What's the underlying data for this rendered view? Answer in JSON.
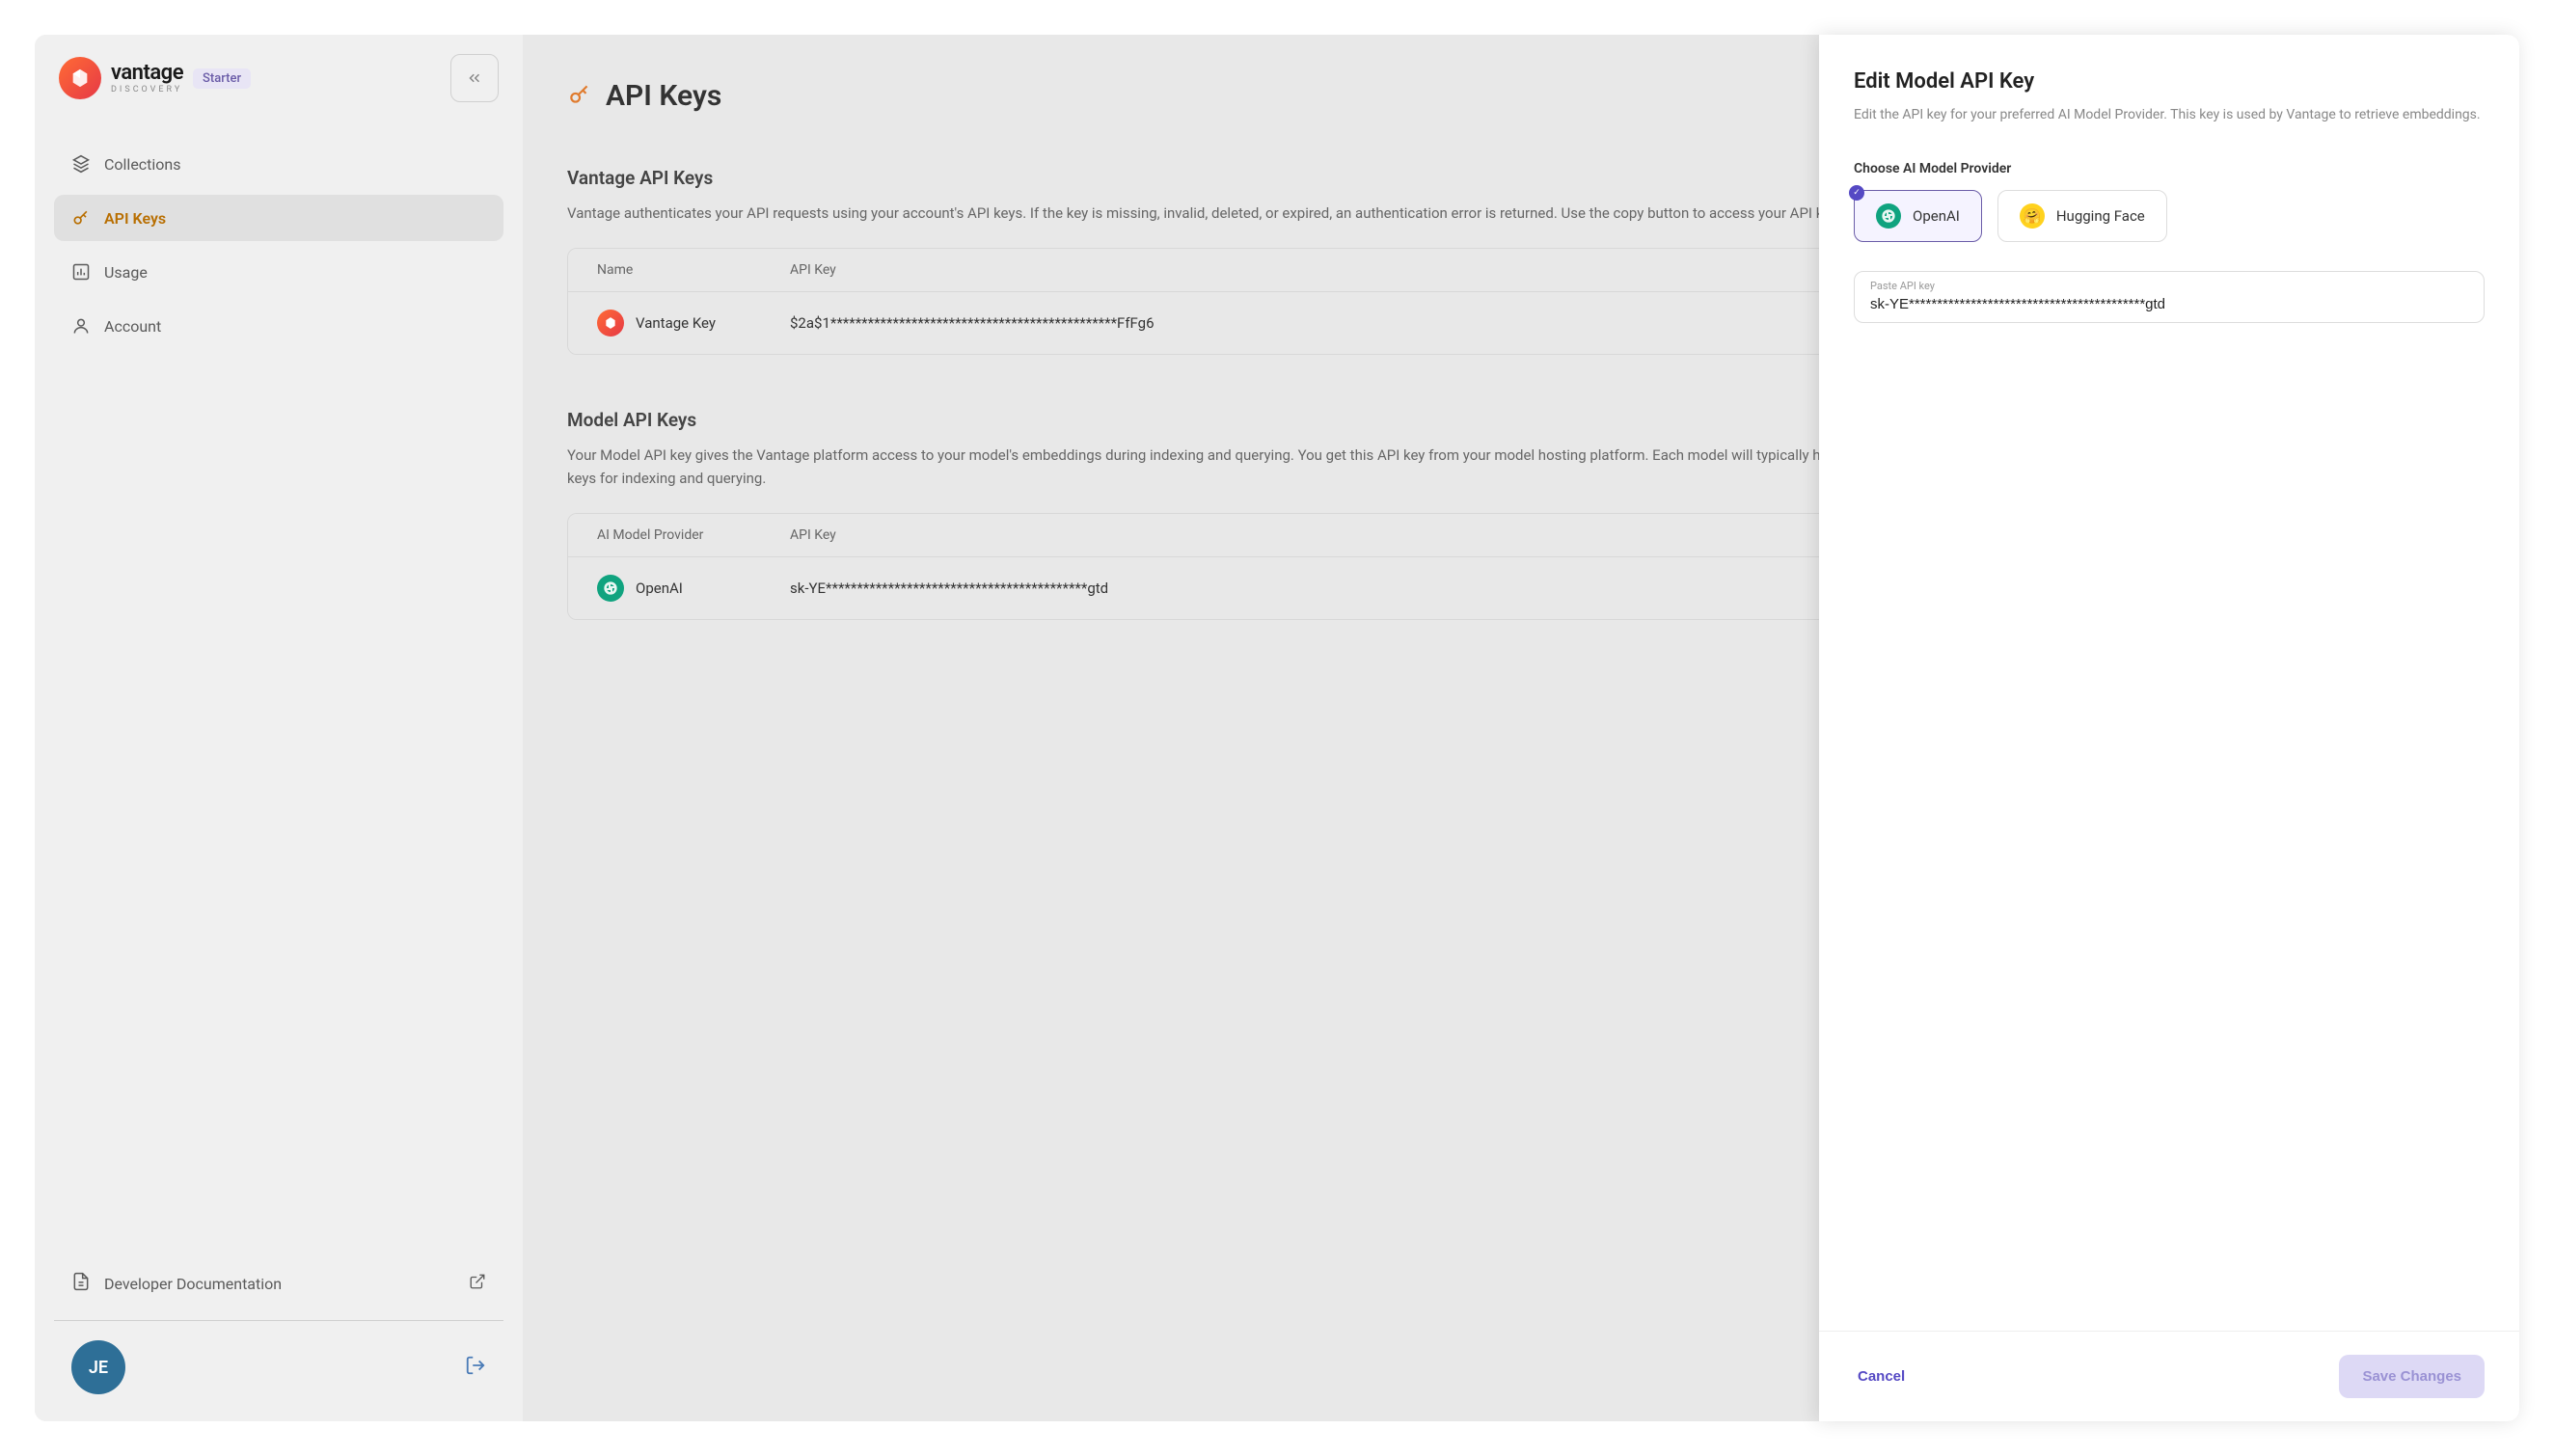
{
  "brand": {
    "name": "vantage",
    "subtitle": "DISCOVERY",
    "plan_badge": "Starter"
  },
  "nav": {
    "items": [
      {
        "label": "Collections"
      },
      {
        "label": "API Keys"
      },
      {
        "label": "Usage"
      },
      {
        "label": "Account"
      }
    ]
  },
  "sidebar_footer": {
    "doc_link": "Developer Documentation",
    "user_initials": "JE"
  },
  "page": {
    "title": "API Keys"
  },
  "vantage_keys": {
    "title": "Vantage API Keys",
    "desc": "Vantage authenticates your API requests using your account's API keys. If the key is missing, invalid, deleted, or expired, an authentication error is returned. Use the copy button to access your API key. Do not share your API key.",
    "columns": {
      "name": "Name",
      "key": "API Key"
    },
    "rows": [
      {
        "name": "Vantage Key",
        "key": "$2a$1**********************************************FfFg6"
      }
    ]
  },
  "model_keys": {
    "title": "Model API Keys",
    "desc": "Your Model API key gives the Vantage platform access to your model's embeddings during indexing and querying. You get this API key from your model hosting platform. Each model will typically have its own key. If your model uses API access quotas (like OpenAI), you will typically have separate keys for indexing and querying.",
    "columns": {
      "provider": "AI Model Provider",
      "key": "API Key"
    },
    "rows": [
      {
        "provider": "OpenAI",
        "key": "sk-YE******************************************gtd"
      }
    ]
  },
  "panel": {
    "title": "Edit Model API Key",
    "desc": "Edit the API key for your preferred AI Model Provider. This key is used by Vantage to retrieve embeddings.",
    "provider_label": "Choose AI Model Provider",
    "providers": [
      {
        "label": "OpenAI"
      },
      {
        "label": "Hugging Face"
      }
    ],
    "input_label": "Paste API key",
    "input_value": "sk-YE******************************************gtd",
    "cancel": "Cancel",
    "save": "Save Changes"
  }
}
